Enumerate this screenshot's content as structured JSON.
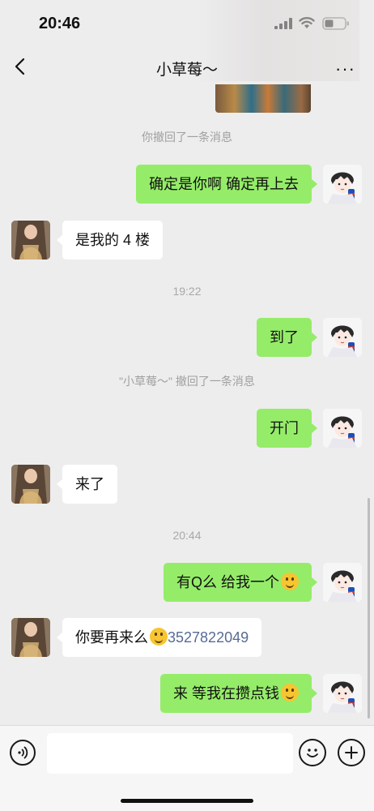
{
  "status_bar": {
    "time": "20:46",
    "icons": [
      "signal-icon",
      "wifi-icon",
      "battery-icon"
    ]
  },
  "header": {
    "back_icon": "back-chevron-icon",
    "title": "小草莓～",
    "more_icon": "more-dots-icon",
    "more_text": "···"
  },
  "chat": {
    "items": [
      {
        "type": "image",
        "from": "me"
      },
      {
        "type": "system",
        "text": "你撤回了一条消息"
      },
      {
        "type": "message",
        "from": "me",
        "text": "确定是你啊 确定再上去"
      },
      {
        "type": "message",
        "from": "her",
        "text": "是我的 4 楼"
      },
      {
        "type": "timestamp",
        "text": "19:22"
      },
      {
        "type": "message",
        "from": "me",
        "text": "到了"
      },
      {
        "type": "system",
        "text": "\"小草莓～\" 撤回了一条消息"
      },
      {
        "type": "message",
        "from": "me",
        "text": "开门"
      },
      {
        "type": "message",
        "from": "her",
        "text": "来了"
      },
      {
        "type": "timestamp",
        "text": "20:44"
      },
      {
        "type": "message",
        "from": "me",
        "text": "有Q么 给我一个",
        "emoji": "woozy-face-emoji"
      },
      {
        "type": "message",
        "from": "her",
        "text": "你要再来么",
        "emoji": "thinking-face-emoji",
        "link": "3527822049"
      },
      {
        "type": "message",
        "from": "me",
        "text": "来 等我在攒点钱",
        "emoji": "grimacing-face-emoji"
      }
    ]
  },
  "input_bar": {
    "voice_icon": "voice-icon",
    "input_value": "",
    "emoji_icon": "emoji-icon",
    "plus_icon": "plus-icon"
  },
  "colors": {
    "background": "#ededed",
    "my_bubble": "#95ec69",
    "her_bubble": "#ffffff",
    "system_text": "#a0a0a0",
    "link": "#576b95"
  }
}
